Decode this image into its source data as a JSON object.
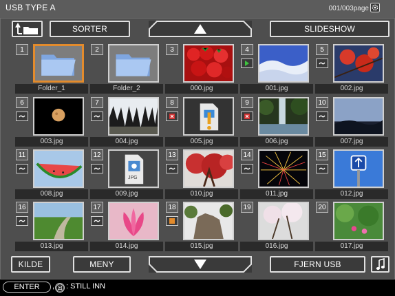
{
  "header": {
    "title": "USB TYPE A",
    "page": "001/003page",
    "settings_icon": "gear-icon"
  },
  "toolbar": {
    "up_folder_icon": "folder-up-icon",
    "sorter": "SORTER",
    "page_up_icon": "triangle-up-icon",
    "slideshow": "SLIDESHOW"
  },
  "footer_buttons": {
    "kilde": "KILDE",
    "meny": "MENY",
    "page_down_icon": "triangle-down-icon",
    "fjern_usb": "FJERN USB",
    "music_icon": "music-note-icon"
  },
  "status": {
    "enter": "ENTER",
    "separator": ",",
    "still_label": ": STILL INN"
  },
  "colors": {
    "selected": "#e38b2c",
    "panel": "#4e4e4e",
    "play": "#3ec43e",
    "error": "#d03030"
  },
  "items": [
    {
      "num": "1",
      "name": "Folder_1",
      "kind": "folder",
      "badge": ""
    },
    {
      "num": "2",
      "name": "Folder_2",
      "kind": "folder",
      "badge": ""
    },
    {
      "num": "3",
      "name": "000.jpg",
      "kind": "strawberries",
      "badge": ""
    },
    {
      "num": "4",
      "name": "001.jpg",
      "kind": "snow",
      "badge": "play"
    },
    {
      "num": "5",
      "name": "002.jpg",
      "kind": "maple",
      "badge": "~"
    },
    {
      "num": "6",
      "name": "003.jpg",
      "kind": "moon",
      "badge": "~"
    },
    {
      "num": "7",
      "name": "004.jpg",
      "kind": "icicles",
      "badge": "~"
    },
    {
      "num": "8",
      "name": "005.jpg",
      "kind": "file-warning",
      "badge": "x"
    },
    {
      "num": "9",
      "name": "006.jpg",
      "kind": "waterfall",
      "badge": "x"
    },
    {
      "num": "10",
      "name": "007.jpg",
      "kind": "sky",
      "badge": "~"
    },
    {
      "num": "11",
      "name": "008.jpg",
      "kind": "watermelon",
      "badge": "~"
    },
    {
      "num": "12",
      "name": "009.jpg",
      "kind": "jpg-file",
      "badge": "~"
    },
    {
      "num": "13",
      "name": "010.jpg",
      "kind": "red-tree",
      "badge": "~"
    },
    {
      "num": "14",
      "name": "011.jpg",
      "kind": "fireworks",
      "badge": "~"
    },
    {
      "num": "15",
      "name": "012.jpg",
      "kind": "sign",
      "badge": "~"
    },
    {
      "num": "16",
      "name": "013.jpg",
      "kind": "path",
      "badge": "~"
    },
    {
      "num": "17",
      "name": "014.jpg",
      "kind": "lotus",
      "badge": "~"
    },
    {
      "num": "18",
      "name": "015.jpg",
      "kind": "rock",
      "badge": "stop"
    },
    {
      "num": "19",
      "name": "016.jpg",
      "kind": "blossom",
      "badge": ""
    },
    {
      "num": "20",
      "name": "017.jpg",
      "kind": "garden",
      "badge": ""
    }
  ],
  "jpg_label": "JPG"
}
